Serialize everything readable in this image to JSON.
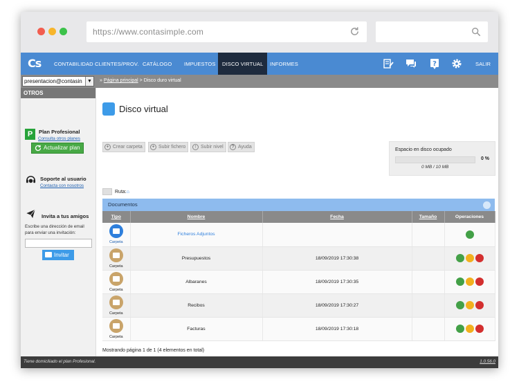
{
  "browser": {
    "url": "https://www.contasimple.com",
    "search_value": ""
  },
  "app": {
    "logo_text": "Cs",
    "nav": [
      {
        "label": "CONTABILIDAD"
      },
      {
        "label": "CLIENTES/PROV."
      },
      {
        "label": "CATÁLOGO"
      },
      {
        "label": "IMPUESTOS"
      },
      {
        "label": "DISCO VIRTUAL",
        "active": true
      },
      {
        "label": "INFORMES"
      }
    ],
    "nav_icons": [
      "edit-list-icon",
      "chat-icon",
      "help-icon",
      "gear-icon"
    ],
    "exit_label": "SALIR"
  },
  "subbar": {
    "account": "presentacion@contasin",
    "breadcrumb_prefix": "» ",
    "breadcrumb_link": "Página principal",
    "breadcrumb_rest": " > Disco duro virtual"
  },
  "sidebar": {
    "header": "OTROS",
    "plan": {
      "badge": "P",
      "title": "Plan Profesional",
      "link": "Consulta otros planes",
      "button": "Actualizar plan"
    },
    "support": {
      "title": "Soporte al usuario",
      "link": "Contacta con nosotros"
    },
    "invite": {
      "title": "Invita a tus amigos",
      "text": "Escribe una dirección de email para enviar una invitación:",
      "email_value": "",
      "button": "Invitar"
    }
  },
  "main": {
    "title": "Disco virtual",
    "toolbar": [
      {
        "label": "Crear carpeta",
        "icon": "plus-icon"
      },
      {
        "label": "Subir fichero",
        "icon": "plus-icon"
      },
      {
        "label": "Subir nivel",
        "icon": "arrow-up-icon"
      },
      {
        "label": "Ayuda",
        "icon": "question-icon"
      }
    ],
    "disk": {
      "label": "Espacio en disco ocupado",
      "percent": "0 %",
      "percent_value": 0,
      "usage": "0 MB / 10 MB"
    },
    "route_label": "Ruta:",
    "panel_title": "Documentos",
    "columns": [
      "Tipo",
      "Nombre",
      "Fecha",
      "Tamaño",
      "Operaciones"
    ],
    "rows": [
      {
        "type": "Carpeta",
        "name": "Ficheros Adjuntos",
        "date": "",
        "size": "",
        "ops": [
          "go"
        ],
        "style": "blue"
      },
      {
        "type": "Carpeta",
        "name": "Presupuestos",
        "date": "18/09/2019 17:30:38",
        "size": "",
        "ops": [
          "go",
          "edit",
          "delete"
        ],
        "style": "tan"
      },
      {
        "type": "Carpeta",
        "name": "Albaranes",
        "date": "18/09/2019 17:30:35",
        "size": "",
        "ops": [
          "go",
          "edit",
          "delete"
        ],
        "style": "tan"
      },
      {
        "type": "Carpeta",
        "name": "Recibos",
        "date": "18/09/2019 17:30:27",
        "size": "",
        "ops": [
          "go",
          "edit",
          "delete"
        ],
        "style": "tan"
      },
      {
        "type": "Carpeta",
        "name": "Facturas",
        "date": "18/09/2019 17:30:18",
        "size": "",
        "ops": [
          "go",
          "edit",
          "delete"
        ],
        "style": "tan"
      }
    ],
    "pager": "Mostrando página 1 de 1 (4 elementos en total)"
  },
  "footer": {
    "left": "Tiene domiciliado el plan Profesional.",
    "version": "1.0.56.0"
  }
}
